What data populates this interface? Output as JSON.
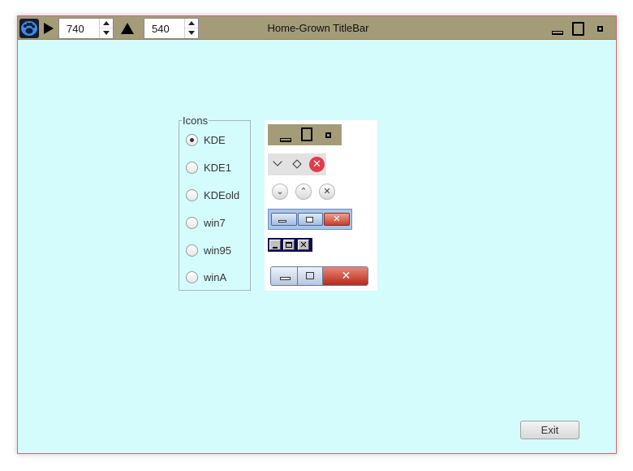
{
  "window": {
    "title": "Home-Grown TitleBar",
    "width_value": "740",
    "height_value": "540",
    "background_color": "#d4fcfc",
    "titlebar_color": "#a49c78"
  },
  "icons_group": {
    "legend": "Icons",
    "selected": "KDE",
    "options": [
      {
        "label": "KDE",
        "checked": true
      },
      {
        "label": "KDE1",
        "checked": false
      },
      {
        "label": "KDEold",
        "checked": false
      },
      {
        "label": "win7",
        "checked": false
      },
      {
        "label": "win95",
        "checked": false
      },
      {
        "label": "winA",
        "checked": false
      }
    ]
  },
  "preview": {
    "kde1_close_glyph": "✕",
    "kdeold_glyphs": [
      "⌄",
      "⌃",
      "✕"
    ],
    "win7_close_glyph": "✕",
    "win95_close_glyph": "✕",
    "wina_close_glyph": "✕"
  },
  "footer": {
    "exit_label": "Exit"
  }
}
